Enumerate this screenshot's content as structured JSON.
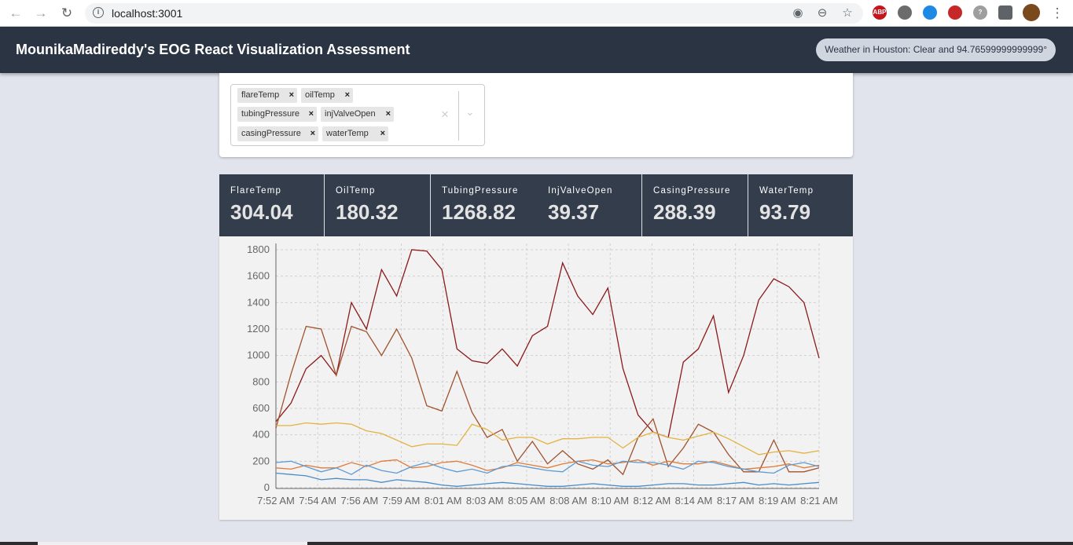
{
  "browser": {
    "url": "localhost:3001",
    "back_icon": "arrow-left-icon",
    "forward_icon": "arrow-right-icon",
    "reload_icon": "reload-icon",
    "extensions": [
      {
        "name": "abp-extension-icon",
        "text": "ABP",
        "color": "#c4161c"
      },
      {
        "name": "grey-circle-extension-icon",
        "text": "",
        "color": "#6b6b6b"
      },
      {
        "name": "globe-extension-icon",
        "text": "",
        "color": "#1e88e5"
      },
      {
        "name": "red-square-extension-icon",
        "text": "",
        "color": "#c62828"
      },
      {
        "name": "question-extension-icon",
        "text": "?",
        "color": "#9e9e9e"
      },
      {
        "name": "puzzle-extension-icon",
        "text": "",
        "color": "#5f6368"
      },
      {
        "name": "profile-avatar",
        "text": "",
        "color": "#7a4a1e"
      }
    ]
  },
  "header": {
    "title": "MounikaMadireddy's EOG React Visualization Assessment",
    "weather": "Weather in Houston: Clear and 94.76599999999999°"
  },
  "select": {
    "chips": [
      "flareTemp",
      "oilTemp",
      "tubingPressure",
      "injValveOpen",
      "casingPressure",
      "waterTemp"
    ]
  },
  "metrics": [
    {
      "label": "FlareTemp",
      "value": "304.04"
    },
    {
      "label": "OilTemp",
      "value": "180.32"
    },
    {
      "label": "TubingPressure",
      "value": "1268.82"
    },
    {
      "label": "InjValveOpen",
      "value": "39.37"
    },
    {
      "label": "CasingPressure",
      "value": "288.39"
    },
    {
      "label": "WaterTemp",
      "value": "93.79"
    }
  ],
  "chart_data": {
    "type": "line",
    "ylim": [
      0,
      1800
    ],
    "y_ticks": [
      0,
      200,
      400,
      600,
      800,
      1000,
      1200,
      1400,
      1600,
      1800
    ],
    "x_ticks": [
      "7:52 AM",
      "7:54 AM",
      "7:56 AM",
      "7:59 AM",
      "8:01 AM",
      "8:03 AM",
      "8:05 AM",
      "8:08 AM",
      "8:10 AM",
      "8:12 AM",
      "8:14 AM",
      "8:17 AM",
      "8:19 AM",
      "8:21 AM"
    ],
    "grid": true,
    "series": [
      {
        "color": "#8b1a1a",
        "values": [
          500,
          640,
          900,
          1000,
          850,
          1400,
          1200,
          1650,
          1450,
          1800,
          1790,
          1650,
          1050,
          960,
          940,
          1050,
          920,
          1150,
          1220,
          1700,
          1450,
          1310,
          1510,
          900,
          550,
          420,
          380,
          950,
          1050,
          1300,
          720,
          1000,
          1420,
          1580,
          1520,
          1400,
          980
        ]
      },
      {
        "color": "#a0522d",
        "values": [
          450,
          860,
          1220,
          1200,
          850,
          1220,
          1180,
          1000,
          1200,
          980,
          620,
          580,
          880,
          570,
          380,
          440,
          200,
          350,
          180,
          280,
          180,
          140,
          210,
          100,
          380,
          520,
          160,
          300,
          480,
          420,
          250,
          120,
          120,
          360,
          120,
          120,
          150
        ]
      },
      {
        "color": "#e3b341",
        "values": [
          470,
          470,
          490,
          480,
          490,
          480,
          430,
          410,
          360,
          310,
          330,
          330,
          320,
          480,
          440,
          360,
          380,
          380,
          330,
          370,
          370,
          380,
          380,
          300,
          380,
          420,
          380,
          360,
          390,
          420,
          370,
          310,
          250,
          270,
          280,
          260,
          280
        ]
      },
      {
        "color": "#e07b39",
        "values": [
          150,
          140,
          170,
          150,
          150,
          190,
          160,
          200,
          210,
          150,
          160,
          190,
          200,
          170,
          130,
          150,
          190,
          170,
          150,
          180,
          200,
          210,
          180,
          190,
          210,
          170,
          200,
          180,
          180,
          200,
          170,
          140,
          150,
          160,
          180,
          150,
          170
        ]
      },
      {
        "color": "#5b9bd5",
        "values": [
          190,
          200,
          160,
          120,
          150,
          100,
          170,
          130,
          110,
          160,
          190,
          150,
          120,
          140,
          110,
          160,
          170,
          150,
          130,
          120,
          200,
          170,
          160,
          200,
          190,
          190,
          170,
          140,
          200,
          190,
          160,
          140,
          120,
          110,
          170,
          190,
          160
        ]
      },
      {
        "color": "#4a8cc7",
        "values": [
          110,
          100,
          90,
          60,
          70,
          60,
          60,
          40,
          60,
          50,
          40,
          20,
          10,
          20,
          30,
          40,
          30,
          20,
          10,
          10,
          20,
          30,
          20,
          10,
          10,
          20,
          30,
          30,
          20,
          20,
          30,
          40,
          20,
          30,
          20,
          30,
          40
        ]
      }
    ]
  }
}
